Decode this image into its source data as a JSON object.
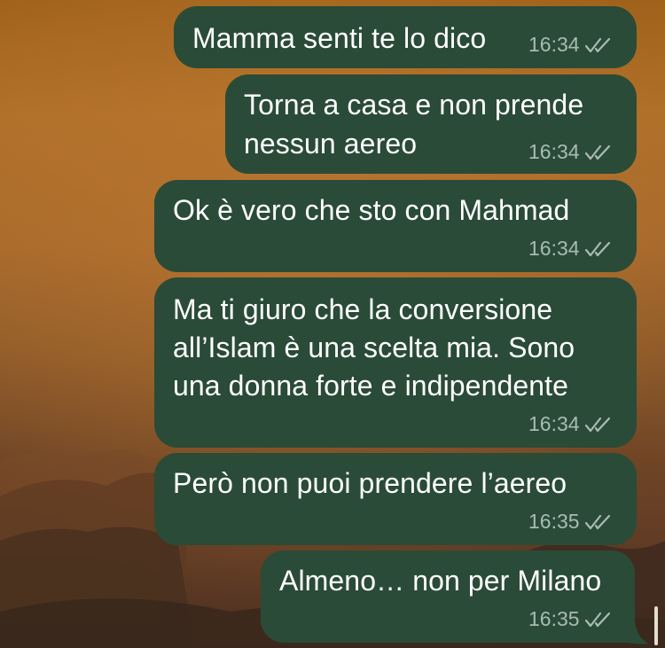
{
  "chat": {
    "messages": [
      {
        "lines": [
          "Mamma senti te lo dico"
        ],
        "time": "16:34",
        "status_icon": "double-check-icon"
      },
      {
        "lines": [
          "Torna a casa e non prende",
          "nessun aereo"
        ],
        "time": "16:34",
        "status_icon": "double-check-icon"
      },
      {
        "lines": [
          "Ok è vero che sto con Mahmad"
        ],
        "time": "16:34",
        "status_icon": "double-check-icon"
      },
      {
        "lines": [
          "Ma ti giuro che la conversione",
          "all’Islam è una scelta mia. Sono",
          "una donna forte e indipendente"
        ],
        "time": "16:34",
        "status_icon": "double-check-icon"
      },
      {
        "lines": [
          "Però non puoi prendere l’aereo"
        ],
        "time": "16:35",
        "status_icon": "double-check-icon"
      },
      {
        "lines": [
          "Almeno… non per Milano"
        ],
        "time": "16:35",
        "status_icon": "double-check-icon"
      }
    ]
  },
  "colors": {
    "bubble": "#2a4b37",
    "text": "#ffffff",
    "meta": "#a9bcb0"
  }
}
